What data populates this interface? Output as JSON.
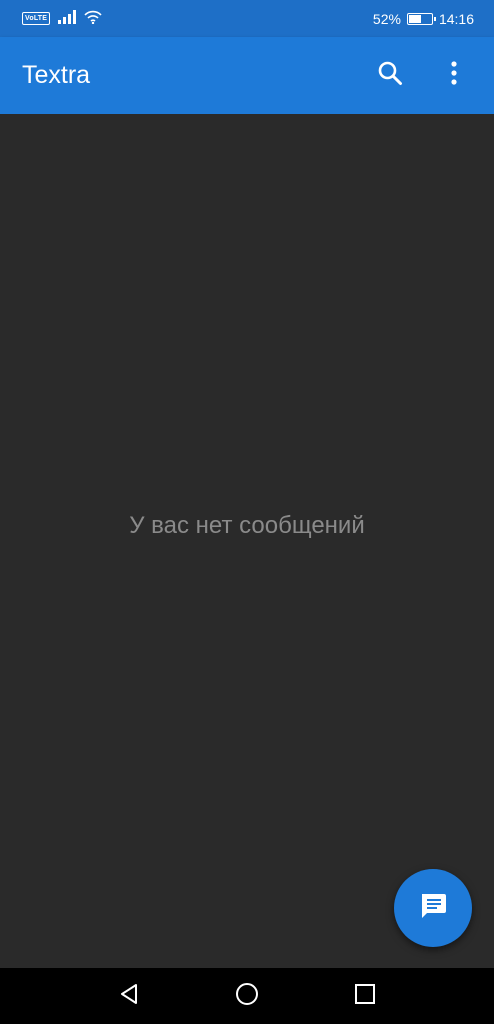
{
  "status_bar": {
    "volte": "VoLTE",
    "battery_percent_label": "52%",
    "battery_level": 0.52,
    "time": "14:16",
    "icons": [
      "volte-icon",
      "signal-icon",
      "wifi-icon",
      "battery-charging-icon"
    ]
  },
  "app_bar": {
    "title": "Textra",
    "actions": [
      "search-icon",
      "more-vert-icon"
    ]
  },
  "content": {
    "empty_message": "У вас нет сообщений"
  },
  "fab": {
    "icon": "new-message-icon"
  },
  "nav_bar": {
    "buttons": [
      "back-icon",
      "home-icon",
      "recents-icon"
    ]
  },
  "colors": {
    "status_bar": "#1e6fc7",
    "app_bar": "#1e7ad8",
    "background": "#2a2a2a",
    "empty_text": "#8a8a8a",
    "fab": "#1e7ad8",
    "nav_bar": "#000000"
  }
}
